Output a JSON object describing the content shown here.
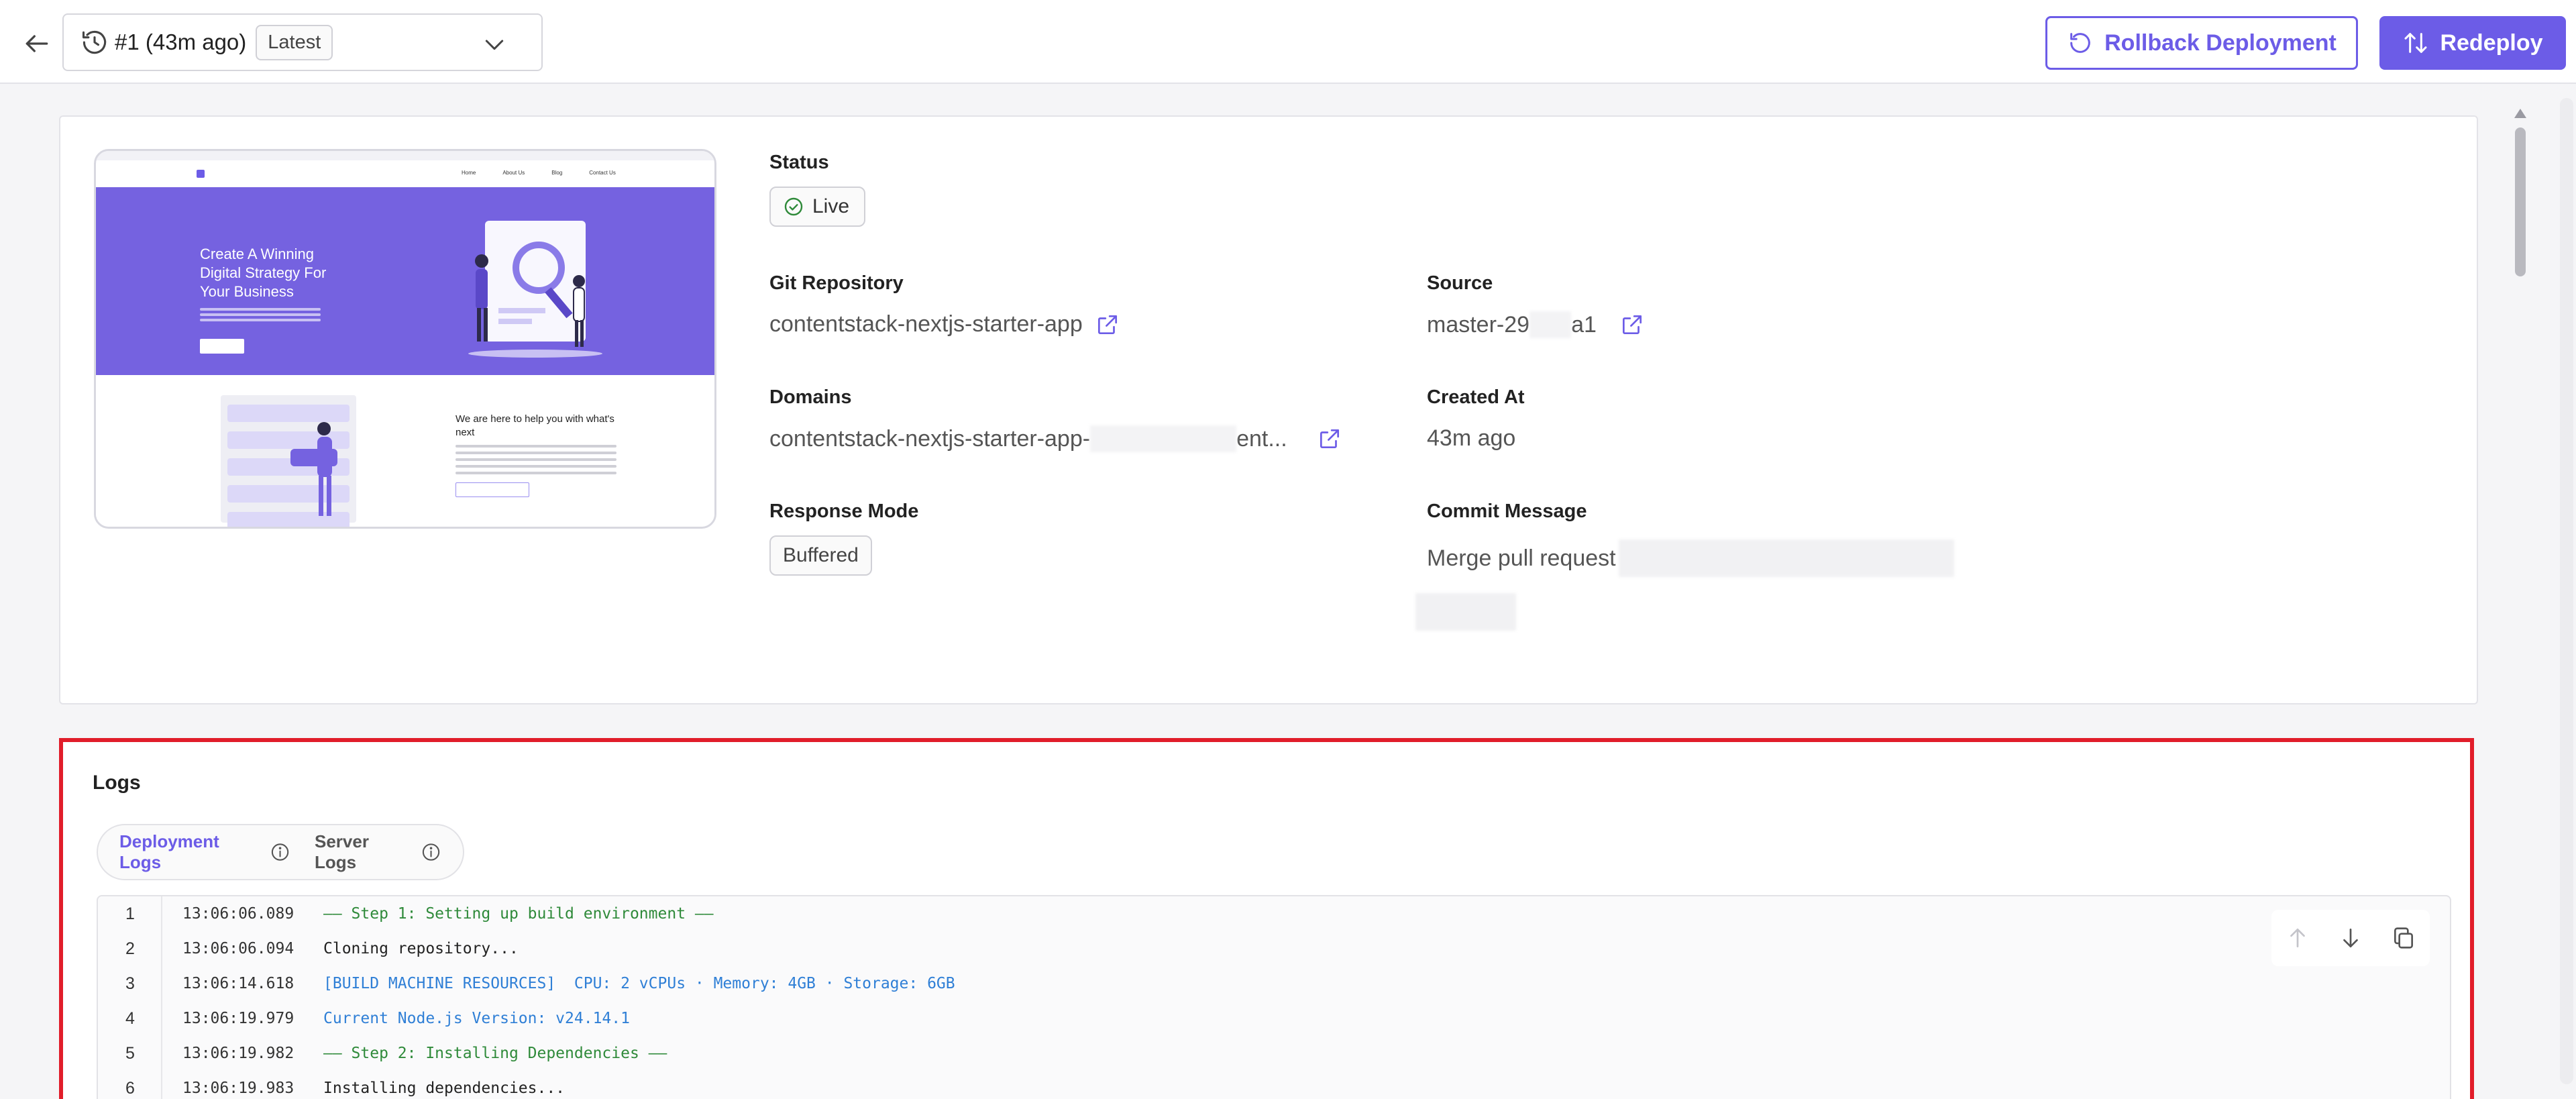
{
  "header": {
    "deployment_label": "#1 (43m ago)",
    "latest_badge": "Latest",
    "rollback_label": "Rollback Deployment",
    "redeploy_label": "Redeploy"
  },
  "preview": {
    "nav_links": [
      "Home",
      "About Us",
      "Blog",
      "Contact Us"
    ],
    "hero_title": "Create A Winning Digital Strategy For Your Business",
    "help_title": "We are here to help you with what's next"
  },
  "details": {
    "status_label": "Status",
    "status_value": "Live",
    "git_repo_label": "Git Repository",
    "git_repo_value": "contentstack-nextjs-starter-app",
    "source_label": "Source",
    "source_value_start": "master-29",
    "source_value_end": "a1",
    "domains_label": "Domains",
    "domains_value_start": "contentstack-nextjs-starter-app-",
    "domains_value_end": "ent...",
    "created_label": "Created At",
    "created_value": "43m ago",
    "response_mode_label": "Response Mode",
    "response_mode_value": "Buffered",
    "commit_label": "Commit Message",
    "commit_value": "Merge pull request"
  },
  "logs": {
    "title": "Logs",
    "tabs": [
      {
        "label": "Deployment Logs",
        "active": true
      },
      {
        "label": "Server Logs",
        "active": false
      }
    ],
    "lines": [
      {
        "n": "1",
        "time": "13:06:06.089",
        "msg": "—— Step 1: Setting up build environment ——",
        "color": "green"
      },
      {
        "n": "2",
        "time": "13:06:06.094",
        "msg": "Cloning repository...",
        "color": "dark"
      },
      {
        "n": "3",
        "time": "13:06:14.618",
        "msg": "[BUILD MACHINE RESOURCES]  CPU: 2 vCPUs · Memory: 4GB · Storage: 6GB",
        "color": "blue"
      },
      {
        "n": "4",
        "time": "13:06:19.979",
        "msg": "Current Node.js Version: v24.14.1",
        "color": "blue"
      },
      {
        "n": "5",
        "time": "13:06:19.982",
        "msg": "—— Step 2: Installing Dependencies ——",
        "color": "green"
      },
      {
        "n": "6",
        "time": "13:06:19.983",
        "msg": "Installing dependencies...",
        "color": "dark"
      }
    ]
  },
  "colors": {
    "accent": "#6c5ce7",
    "highlight_border": "#e11d2a",
    "log_green": "#2f8a3a",
    "log_blue": "#2f7fd6"
  },
  "icons": [
    "back-arrow-icon",
    "history-icon",
    "chevron-down-icon",
    "rollback-icon",
    "redeploy-icon",
    "check-circle-icon",
    "external-link-icon",
    "info-icon",
    "arrow-up-icon",
    "arrow-down-icon",
    "copy-icon"
  ]
}
